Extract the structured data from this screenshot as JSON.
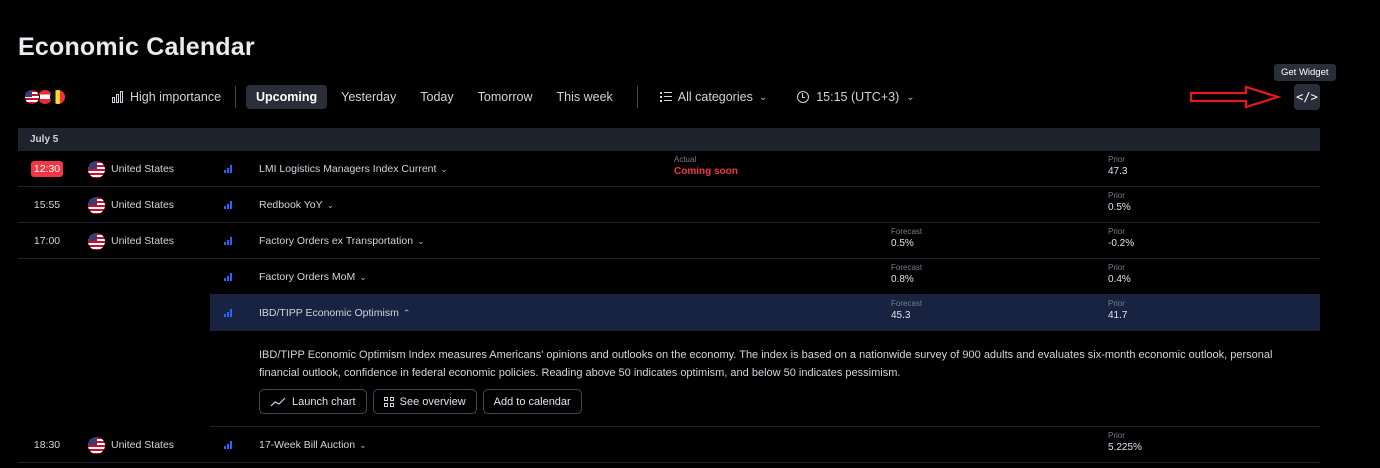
{
  "page": {
    "title": "Economic Calendar"
  },
  "toolbar": {
    "high_importance": "High importance",
    "tabs": [
      "Upcoming",
      "Yesterday",
      "Today",
      "Tomorrow",
      "This week"
    ],
    "categories": "All categories",
    "time": "15:15 (UTC+3)",
    "widget_tooltip": "Get Widget",
    "widget_glyph": "</>"
  },
  "calendar": {
    "date": "July 5",
    "rows": [
      {
        "time": "12:30",
        "country": "United States",
        "event": "LMI Logistics Managers Index Current",
        "actual_label": "Actual",
        "actual": "Coming soon",
        "prior_label": "Prior",
        "prior": "47.3"
      },
      {
        "time": "15:55",
        "country": "United States",
        "event": "Redbook YoY",
        "prior_label": "Prior",
        "prior": "0.5%"
      },
      {
        "time": "17:00",
        "country": "United States",
        "event": "Factory Orders ex Transportation",
        "forecast_label": "Forecast",
        "forecast": "0.5%",
        "prior_label": "Prior",
        "prior": "-0.2%"
      },
      {
        "event": "Factory Orders MoM",
        "forecast_label": "Forecast",
        "forecast": "0.8%",
        "prior_label": "Prior",
        "prior": "0.4%"
      },
      {
        "event": "IBD/TIPP Economic Optimism",
        "forecast_label": "Forecast",
        "forecast": "45.3",
        "prior_label": "Prior",
        "prior": "41.7"
      },
      {
        "time": "18:30",
        "country": "United States",
        "event": "17-Week Bill Auction",
        "prior_label": "Prior",
        "prior": "5.225%"
      }
    ],
    "detail": {
      "text": "IBD/TIPP Economic Optimism Index measures Americans' opinions and outlooks on the economy. The index is based on a nationwide survey of 900 adults and evaluates six-month economic outlook, personal financial outlook, confidence in federal economic policies. Reading above 50 indicates optimism, and below 50 indicates pessimism.",
      "launch_chart": "Launch chart",
      "see_overview": "See overview",
      "add_to_calendar": "Add to calendar"
    }
  },
  "icons": [
    "flag-us-icon",
    "flag-austria-icon",
    "flag-belgium-icon",
    "bar-chart-icon",
    "list-icon",
    "clock-icon",
    "chevron-down-icon",
    "code-icon",
    "importance-bars-icon",
    "line-chart-icon",
    "grid-icon",
    "arrow-annotation"
  ],
  "colors": {
    "background": "#000000",
    "accent_red": "#f23645",
    "importance_blue": "#2962ff",
    "selected_row": "#172340",
    "annotation_arrow": "#e21b1b"
  }
}
